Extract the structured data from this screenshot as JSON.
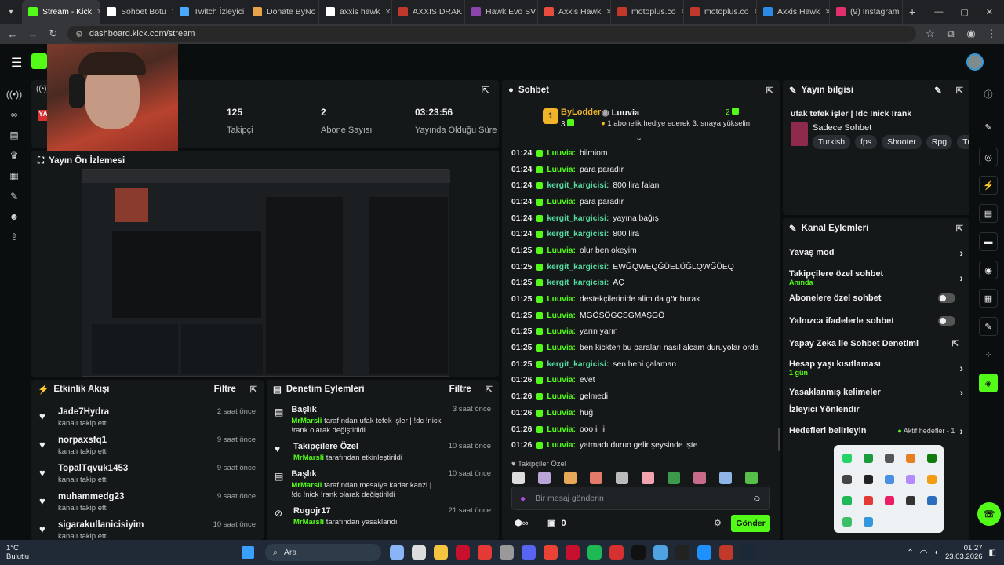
{
  "browser": {
    "tabs": [
      {
        "label": "Stream - Kick",
        "color": "#53fc18"
      },
      {
        "label": "Sohbet Botu",
        "color": "#ffffff"
      },
      {
        "label": "Twitch İzleyici",
        "color": "#4aa8ff"
      },
      {
        "label": "Donate ByNo",
        "color": "#e8a24a"
      },
      {
        "label": "axxis hawk",
        "color": "#ffffff"
      },
      {
        "label": "AXXIS DRAK",
        "color": "#c0392b"
      },
      {
        "label": "Hawk Evo SV",
        "color": "#8e44ad"
      },
      {
        "label": "Axxis Hawk",
        "color": "#e74c3c"
      },
      {
        "label": "motoplus.co",
        "color": "#c0392b"
      },
      {
        "label": "motoplus.co",
        "color": "#c0392b"
      },
      {
        "label": "Axxis Hawk",
        "color": "#2b8be6"
      },
      {
        "label": "(9) Instagram",
        "color": "#e1306c"
      }
    ],
    "url": "dashboard.kick.com/stream"
  },
  "stream": {
    "stats": [
      {
        "value": "125",
        "label": "Takipçi"
      },
      {
        "value": "2",
        "label": "Abone Sayısı"
      },
      {
        "value": "03:23:56",
        "label": "Yayında Olduğu Süre"
      }
    ],
    "preview_title": "Yayın Ön İzlemesi"
  },
  "activity": {
    "title": "Etkinlik Akışı",
    "filter": "Filtre",
    "items": [
      {
        "name": "Jade7Hydra",
        "sub": "kanalı takip etti",
        "time": "2 saat önce"
      },
      {
        "name": "norpaxsfq1",
        "sub": "kanalı takip etti",
        "time": "9 saat önce"
      },
      {
        "name": "TopalTqvuk1453",
        "sub": "kanalı takip etti",
        "time": "9 saat önce"
      },
      {
        "name": "muhammedg23",
        "sub": "kanalı takip etti",
        "time": "9 saat önce"
      },
      {
        "name": "sigarakullanicisiyim",
        "sub": "kanalı takip etti",
        "time": "10 saat önce"
      }
    ]
  },
  "moderation": {
    "title": "Denetim Eylemleri",
    "filter": "Filtre",
    "items": [
      {
        "title": "Başlık",
        "user": "MrMarsli",
        "text": "tarafından ufak tefek işler | !dc !nick !rank olarak değiştirildi",
        "time": "3 saat önce",
        "icon": "list-icon"
      },
      {
        "title": "Takipçilere Özel",
        "user": "MrMarsli",
        "text": "tarafından etkinleştirildi",
        "time": "10 saat önce",
        "icon": "heart-icon"
      },
      {
        "title": "Başlık",
        "user": "MrMarsli",
        "text": "tarafından mesaiye kadar kanzi | !dc !nick !rank olarak değiştirildi",
        "time": "10 saat önce",
        "icon": "list-icon"
      },
      {
        "title": "Rugojr17",
        "user": "MrMarsli",
        "text": "tarafından yasaklandı",
        "time": "21 saat önce",
        "icon": "ban-icon"
      }
    ]
  },
  "chat": {
    "title": "Sohbet",
    "top_gifter": "ByLodder",
    "top_gifter_count": "3",
    "gift_user": "Luuvia",
    "gift_count": "2",
    "gift_text": "1 abonelik hediye ederek 3. sıraya yükselin",
    "messages": [
      {
        "t": "01:24",
        "u": "Luuvia",
        "m": "bilmiom",
        "c": "u1"
      },
      {
        "t": "01:24",
        "u": "Luuvia",
        "m": "para paradır",
        "c": "u1"
      },
      {
        "t": "01:24",
        "u": "kergit_kargicisi",
        "m": "800 lira falan",
        "c": "u2"
      },
      {
        "t": "01:24",
        "u": "Luuvia",
        "m": "para paradır",
        "c": "u1"
      },
      {
        "t": "01:24",
        "u": "kergit_kargicisi",
        "m": "yayına bağış",
        "c": "u2"
      },
      {
        "t": "01:24",
        "u": "kergit_kargicisi",
        "m": "800 lira",
        "c": "u2"
      },
      {
        "t": "01:25",
        "u": "Luuvia",
        "m": "olur ben okeyim",
        "c": "u1"
      },
      {
        "t": "01:25",
        "u": "kergit_kargicisi",
        "m": "EWĞQWEQĞÜELÜĞLQWĞÜEQ",
        "c": "u2"
      },
      {
        "t": "01:25",
        "u": "kergit_kargicisi",
        "m": "AÇ",
        "c": "u2"
      },
      {
        "t": "01:25",
        "u": "Luuvia",
        "m": "destekçilerinide alim da gör burak",
        "c": "u1"
      },
      {
        "t": "01:25",
        "u": "Luuvia",
        "m": "MGÖSÖGÇSGMAŞGÖ",
        "c": "u1"
      },
      {
        "t": "01:25",
        "u": "Luuvia",
        "m": "yarın yarın",
        "c": "u1"
      },
      {
        "t": "01:25",
        "u": "Luuvia",
        "m": "ben kickten bu paraları nasıl alcam duruyolar orda",
        "c": "u1"
      },
      {
        "t": "01:25",
        "u": "kergit_kargicisi",
        "m": "sen beni çalaman",
        "c": "u2"
      },
      {
        "t": "01:26",
        "u": "Luuvia",
        "m": "evet",
        "c": "u1"
      },
      {
        "t": "01:26",
        "u": "Luuvia",
        "m": "gelmedi",
        "c": "u1"
      },
      {
        "t": "01:26",
        "u": "Luuvia",
        "m": "hüğ",
        "c": "u1"
      },
      {
        "t": "01:26",
        "u": "Luuvia",
        "m": "ooo ii ii",
        "c": "u1"
      },
      {
        "t": "01:26",
        "u": "Luuvia",
        "m": "yatmadı duruo gelir şeysinde işte",
        "c": "u1"
      }
    ],
    "followers_only": "Takipçiler Özel",
    "input_placeholder": "Bir mesaj gönderin",
    "send": "Gönder",
    "points": "0"
  },
  "stream_info": {
    "title": "Yayın bilgisi",
    "stream_title": "ufak tefek işler | !dc !nick !rank",
    "category": "Sadece Sohbet",
    "tags": [
      "Turkish",
      "fps",
      "Shooter",
      "Rpg",
      "Türk"
    ]
  },
  "channel_actions": {
    "title": "Kanal Eylemleri",
    "rows": [
      {
        "label": "Yavaş mod",
        "sub": "",
        "kind": "arrow"
      },
      {
        "label": "Takipçilere özel sohbet",
        "sub": "Anında",
        "kind": "arrow"
      },
      {
        "label": "Abonelere özel sohbet",
        "sub": "",
        "kind": "toggle"
      },
      {
        "label": "Yalnızca ifadelerle sohbet",
        "sub": "",
        "kind": "toggle"
      },
      {
        "label": "Yapay Zeka ile Sohbet Denetimi",
        "sub": "",
        "kind": "ext"
      },
      {
        "label": "Hesap yaşı kısıtlaması",
        "sub": "1 gün",
        "kind": "arrow"
      },
      {
        "label": "Yasaklanmış kelimeler",
        "sub": "",
        "kind": "arrow"
      },
      {
        "label": "İzleyici Yönlendir",
        "sub": "",
        "kind": "none"
      },
      {
        "label": "Hedefleri belirleyin",
        "sub": "",
        "kind": "goal"
      }
    ],
    "goal_status": "Aktif hedefler - 1"
  },
  "taskbar": {
    "weather_temp": "1°C",
    "weather_desc": "Bulutlu",
    "search": "Ara",
    "time": "01:27",
    "date": "23.03.2026"
  }
}
